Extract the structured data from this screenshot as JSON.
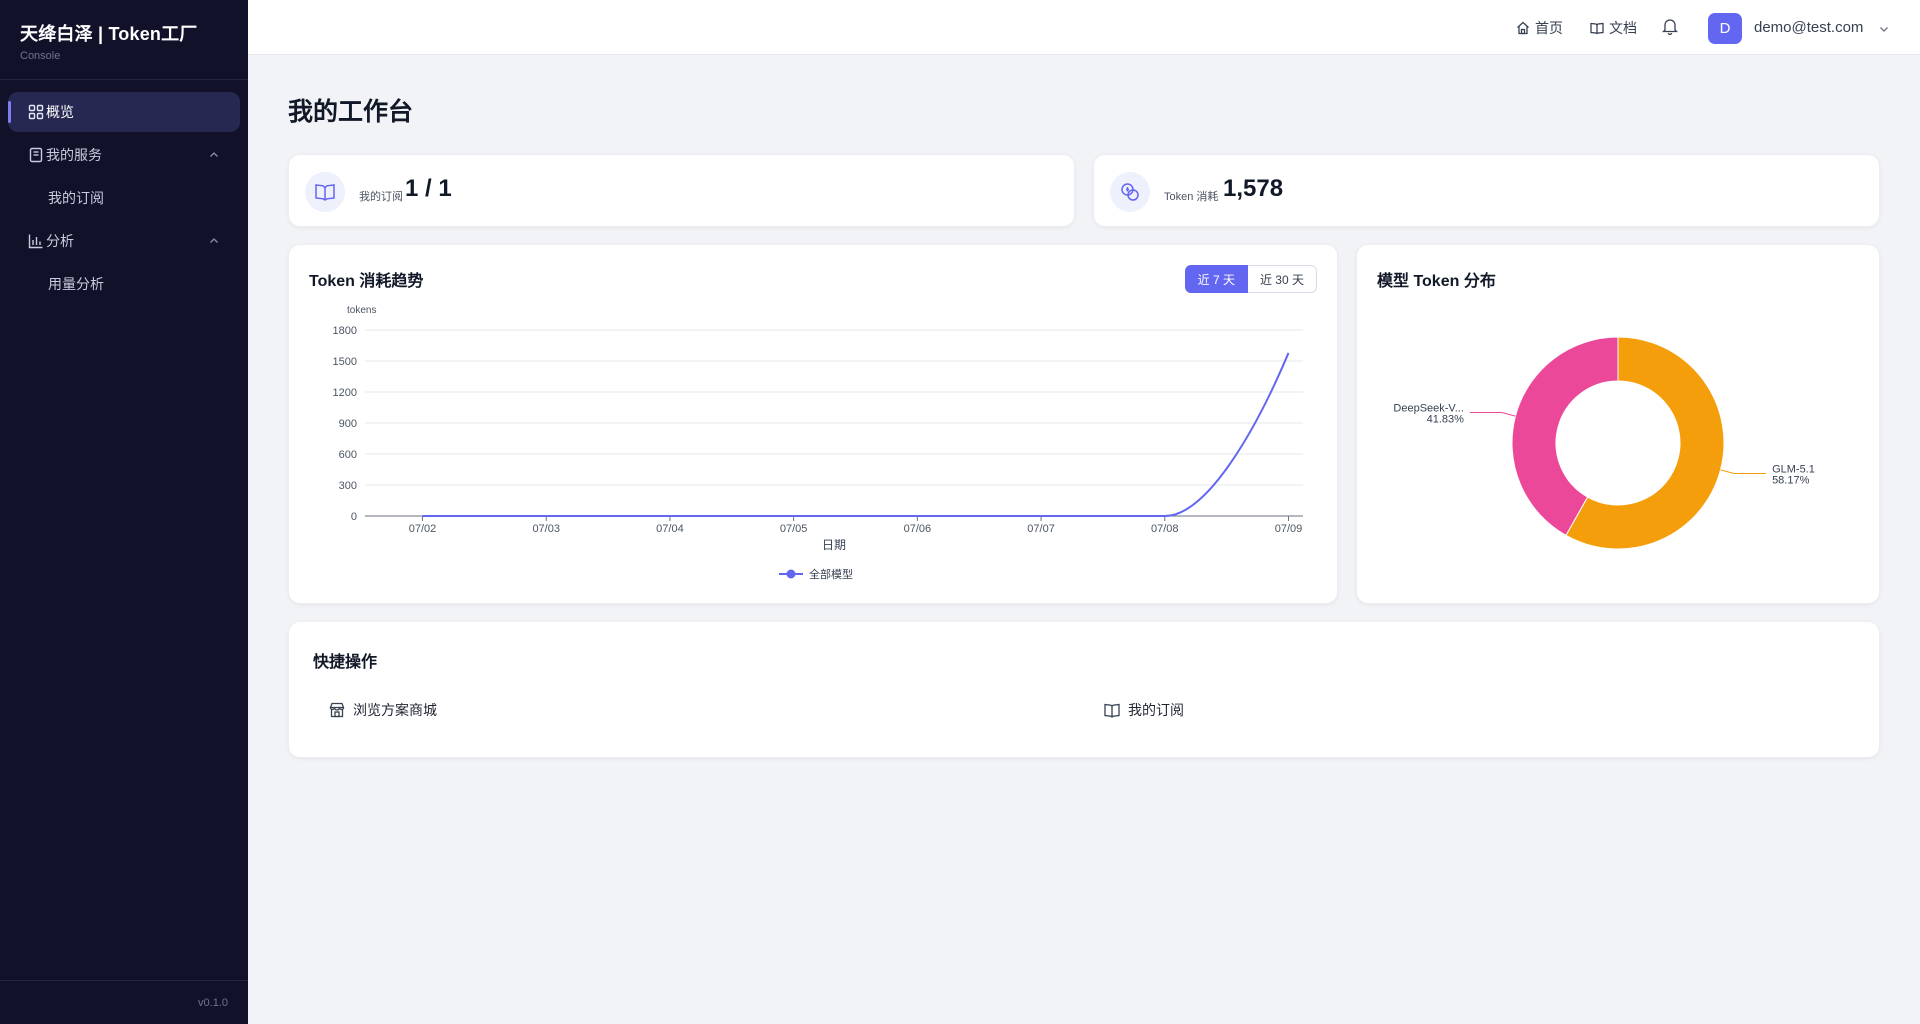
{
  "sidebar": {
    "brand_title": "天绛白泽 | Token工厂",
    "brand_subtitle": "Console",
    "items": [
      {
        "label": "概览",
        "icon": "dashboard-icon"
      },
      {
        "label": "我的服务",
        "icon": "book-icon"
      },
      {
        "label": "我的订阅"
      },
      {
        "label": "分析",
        "icon": "bar-chart-icon"
      },
      {
        "label": "用量分析"
      }
    ],
    "version": "v0.1.0"
  },
  "header": {
    "home_label": "首页",
    "docs_label": "文档",
    "avatar_letter": "D",
    "user_email": "demo@test.com"
  },
  "main": {
    "page_title": "我的工作台",
    "stats": [
      {
        "label": "我的订阅",
        "value": "1 / 1",
        "icon": "book-open-icon"
      },
      {
        "label": "Token 消耗",
        "value": "1,578",
        "icon": "coins-icon"
      }
    ],
    "trend_title": "Token 消耗趋势",
    "range_7": "近 7 天",
    "range_30": "近 30 天",
    "dist_title": "模型 Token 分布",
    "quick_title": "快捷操作",
    "quick_actions": [
      {
        "label": "浏览方案商城",
        "icon": "store-icon"
      },
      {
        "label": "我的订阅",
        "icon": "book-open-icon"
      }
    ]
  },
  "chart_data": [
    {
      "type": "line",
      "title": "Token 消耗趋势",
      "xlabel": "日期",
      "ylabel": "tokens",
      "x": [
        "07/02",
        "07/03",
        "07/04",
        "07/05",
        "07/06",
        "07/07",
        "07/08",
        "07/09"
      ],
      "ylim": [
        0,
        1800
      ],
      "yticks": [
        0,
        300,
        600,
        900,
        1200,
        1500,
        1800
      ],
      "grid": true,
      "legend": "bottom",
      "series": [
        {
          "name": "全部模型",
          "values": [
            0,
            0,
            0,
            0,
            0,
            0,
            0,
            1578
          ],
          "color": "#6366f1"
        }
      ]
    },
    {
      "type": "pie",
      "title": "模型 Token 分布",
      "slices": [
        {
          "label": "GLM-5.1",
          "percent": "58.17%",
          "value": 58.17,
          "color": "#f59e0b"
        },
        {
          "label": "DeepSeek-V...",
          "percent": "41.83%",
          "value": 41.83,
          "color": "#ec4899"
        }
      ]
    }
  ]
}
